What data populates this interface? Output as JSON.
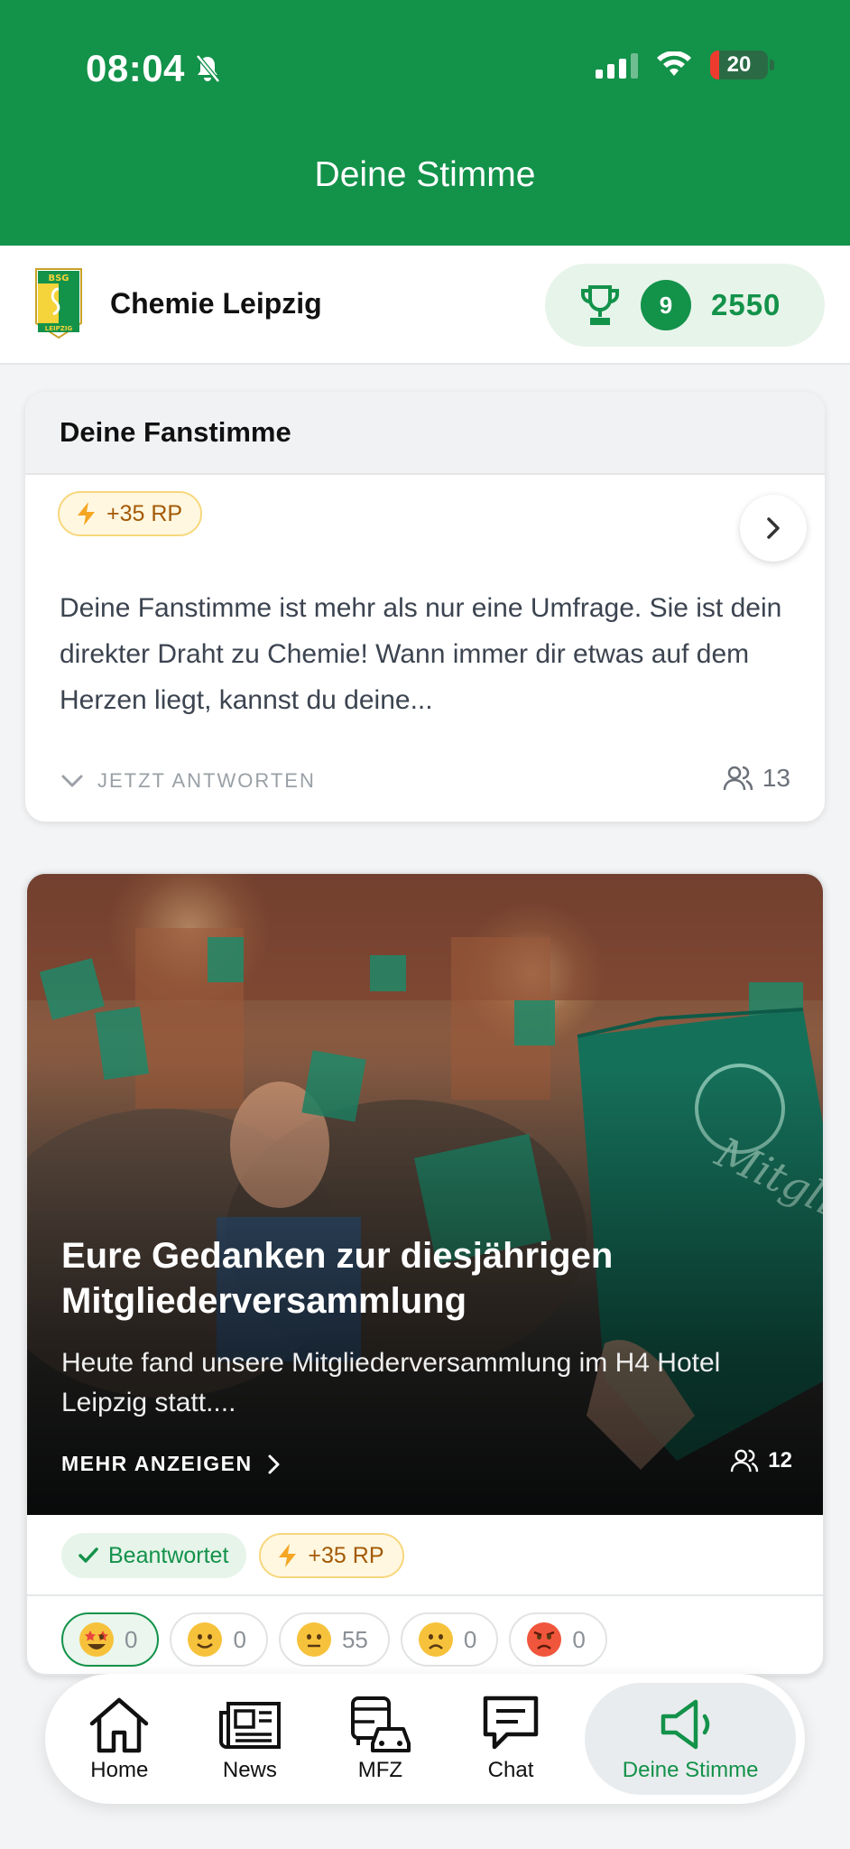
{
  "status_bar": {
    "time": "08:04",
    "battery": "20"
  },
  "header": {
    "title": "Deine Stimme"
  },
  "club": {
    "name": "Chemie Leipzig",
    "rank": "9",
    "points": "2550"
  },
  "fanstimme_card": {
    "heading": "Deine Fanstimme",
    "reward": "+35 RP",
    "text": "Deine Fanstimme ist mehr als nur eine Umfrage. Sie ist dein direkter Draht zu Chemie! Wann immer dir etwas auf dem Herzen liegt, kannst du deine...",
    "action": "JETZT ANTWORTEN",
    "participants": "13"
  },
  "survey_card": {
    "title": "Eure Gedanken zur diesjährigen Mitgliederversammlung",
    "description": "Heute fand unsere Mitgliederversammlung im H4 Hotel Leipzig statt....",
    "more": "MEHR ANZEIGEN",
    "participants": "12",
    "status": "Beantwortet",
    "reward": "+35 RP",
    "reactions": [
      {
        "emoji": "star-struck-emoji",
        "count": "0",
        "active": true
      },
      {
        "emoji": "slightly-smiling-emoji",
        "count": "0",
        "active": false
      },
      {
        "emoji": "neutral-face-emoji",
        "count": "55",
        "active": false
      },
      {
        "emoji": "slightly-frowning-emoji",
        "count": "0",
        "active": false
      },
      {
        "emoji": "angry-face-emoji",
        "count": "0",
        "active": false
      }
    ]
  },
  "nav": {
    "items": [
      {
        "label": "Home",
        "icon": "home-icon"
      },
      {
        "label": "News",
        "icon": "newspaper-icon"
      },
      {
        "label": "MFZ",
        "icon": "vehicles-icon"
      },
      {
        "label": "Chat",
        "icon": "chat-icon"
      },
      {
        "label": "Deine Stimme",
        "icon": "megaphone-icon",
        "active": true
      }
    ]
  },
  "colors": {
    "brand_green": "#13924a",
    "reward_orange": "#a35a06",
    "reward_bg": "#fff7e0"
  }
}
